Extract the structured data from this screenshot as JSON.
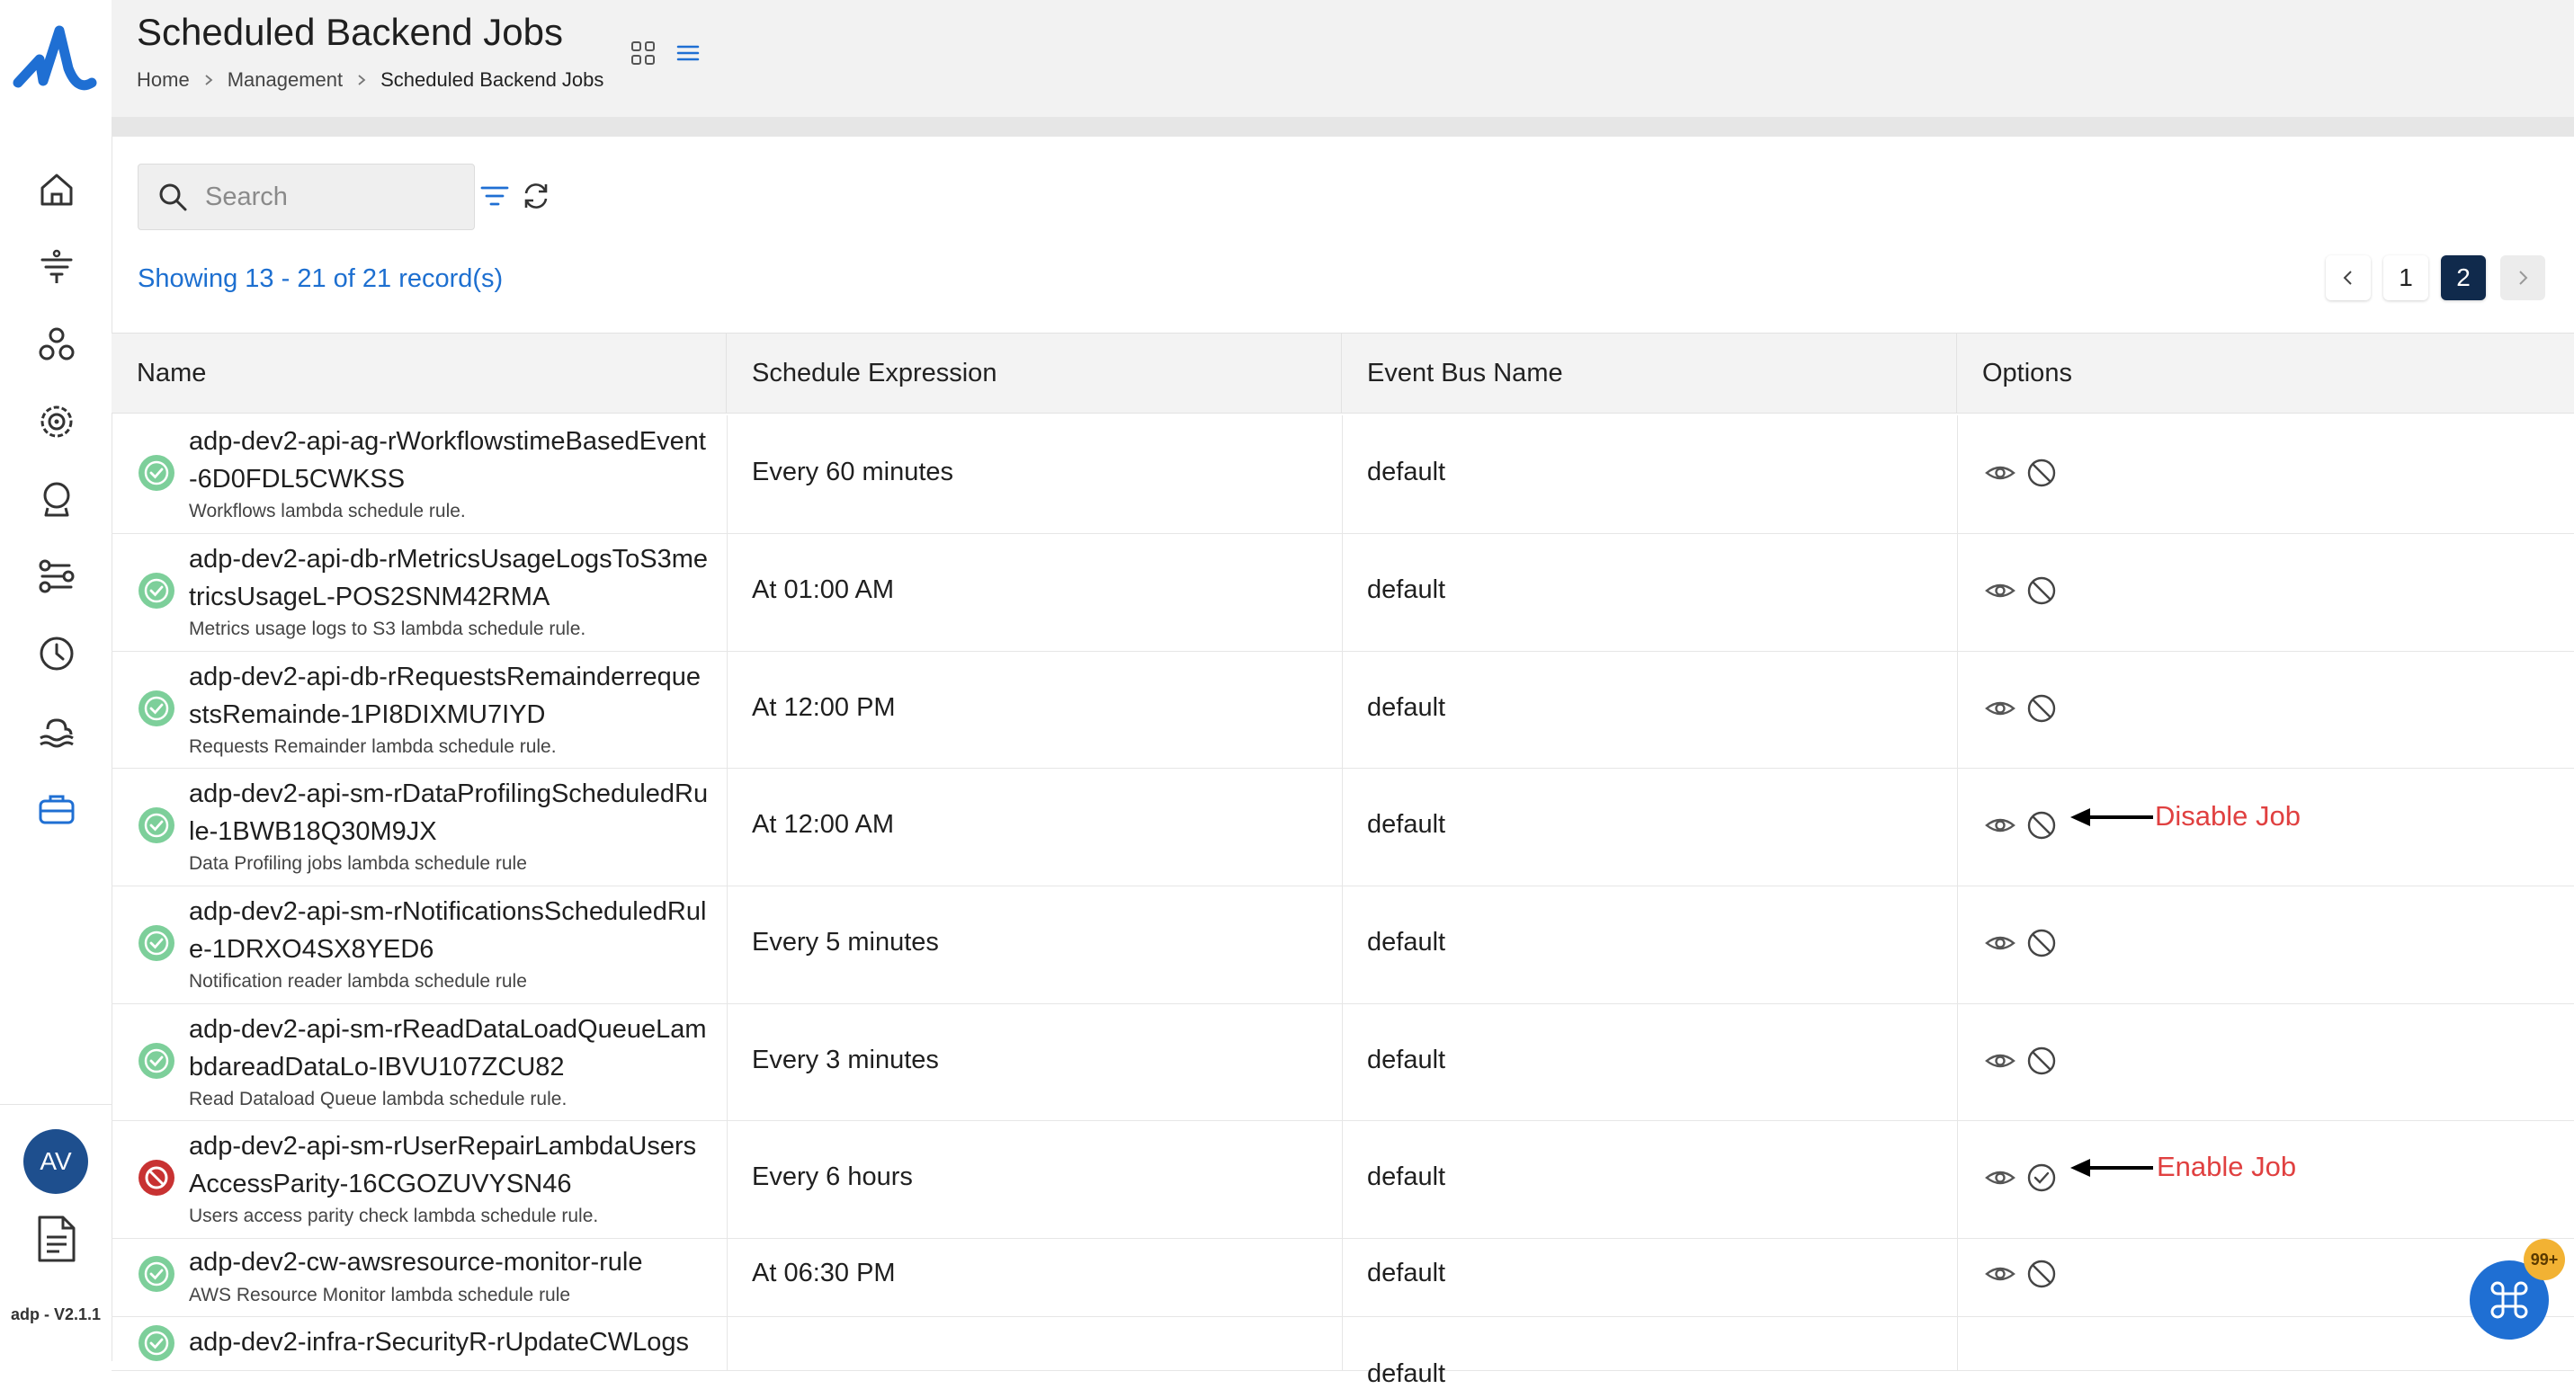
{
  "app": {
    "version": "adp - V2.1.1",
    "avatar_initials": "AV",
    "brand_color": "#1f6fd3"
  },
  "header": {
    "title": "Scheduled Backend Jobs",
    "breadcrumb": [
      "Home",
      "Management",
      "Scheduled Backend Jobs"
    ]
  },
  "sidebar": {
    "items": [
      {
        "icon": "home-icon"
      },
      {
        "icon": "funnel-icon"
      },
      {
        "icon": "network-icon"
      },
      {
        "icon": "settings-target-icon"
      },
      {
        "icon": "crystal-ball-icon"
      },
      {
        "icon": "workflow-icon"
      },
      {
        "icon": "clock-icon"
      },
      {
        "icon": "datalake-icon"
      },
      {
        "icon": "briefcase-icon"
      }
    ]
  },
  "toolbar": {
    "search_placeholder": "Search",
    "records_text": "Showing 13 - 21 of 21 record(s)"
  },
  "pagination": {
    "pages": [
      "1",
      "2"
    ],
    "current": "2"
  },
  "table": {
    "columns": [
      "Name",
      "Schedule Expression",
      "Event Bus Name",
      "Options"
    ],
    "rows": [
      {
        "name": "adp-dev2-api-ag-rWorkflowstimeBasedEvent-6D0FDL5CWKSS",
        "desc": "Workflows lambda schedule rule.",
        "schedule": "Every 60 minutes",
        "bus": "default",
        "enabled": true
      },
      {
        "name": "adp-dev2-api-db-rMetricsUsageLogsToS3metricsUsageL-POS2SNM42RMA",
        "desc": "Metrics usage logs to S3 lambda schedule rule.",
        "schedule": "At 01:00 AM",
        "bus": "default",
        "enabled": true
      },
      {
        "name": "adp-dev2-api-db-rRequestsRemainderrequestsRemainde-1PI8DIXMU7IYD",
        "desc": "Requests Remainder lambda schedule rule.",
        "schedule": "At 12:00 PM",
        "bus": "default",
        "enabled": true
      },
      {
        "name": "adp-dev2-api-sm-rDataProfilingScheduledRule-1BWB18Q30M9JX",
        "desc": "Data Profiling jobs lambda schedule rule",
        "schedule": "At 12:00 AM",
        "bus": "default",
        "enabled": true
      },
      {
        "name": "adp-dev2-api-sm-rNotificationsScheduledRule-1DRXO4SX8YED6",
        "desc": "Notification reader lambda schedule rule",
        "schedule": "Every 5 minutes",
        "bus": "default",
        "enabled": true
      },
      {
        "name": "adp-dev2-api-sm-rReadDataLoadQueueLambdareadDataLo-IBVU107ZCU82",
        "desc": "Read Dataload Queue lambda schedule rule.",
        "schedule": "Every 3 minutes",
        "bus": "default",
        "enabled": true
      },
      {
        "name": "adp-dev2-api-sm-rUserRepairLambdaUsersAccessParity-16CGOZUVYSN46",
        "desc": "Users access parity check lambda schedule rule.",
        "schedule": "Every 6 hours",
        "bus": "default",
        "enabled": false
      },
      {
        "name": "adp-dev2-cw-awsresource-monitor-rule",
        "desc": "AWS Resource Monitor lambda schedule rule",
        "schedule": "At 06:30 PM",
        "bus": "default",
        "enabled": true
      },
      {
        "name": "adp-dev2-infra-rSecurityR-rUpdateCWLogs",
        "desc": "",
        "schedule": "",
        "bus": "default",
        "enabled": true
      }
    ]
  },
  "annotations": {
    "disable": "Disable Job",
    "enable": "Enable Job",
    "color": "#e04040"
  },
  "fab": {
    "badge": "99+"
  }
}
